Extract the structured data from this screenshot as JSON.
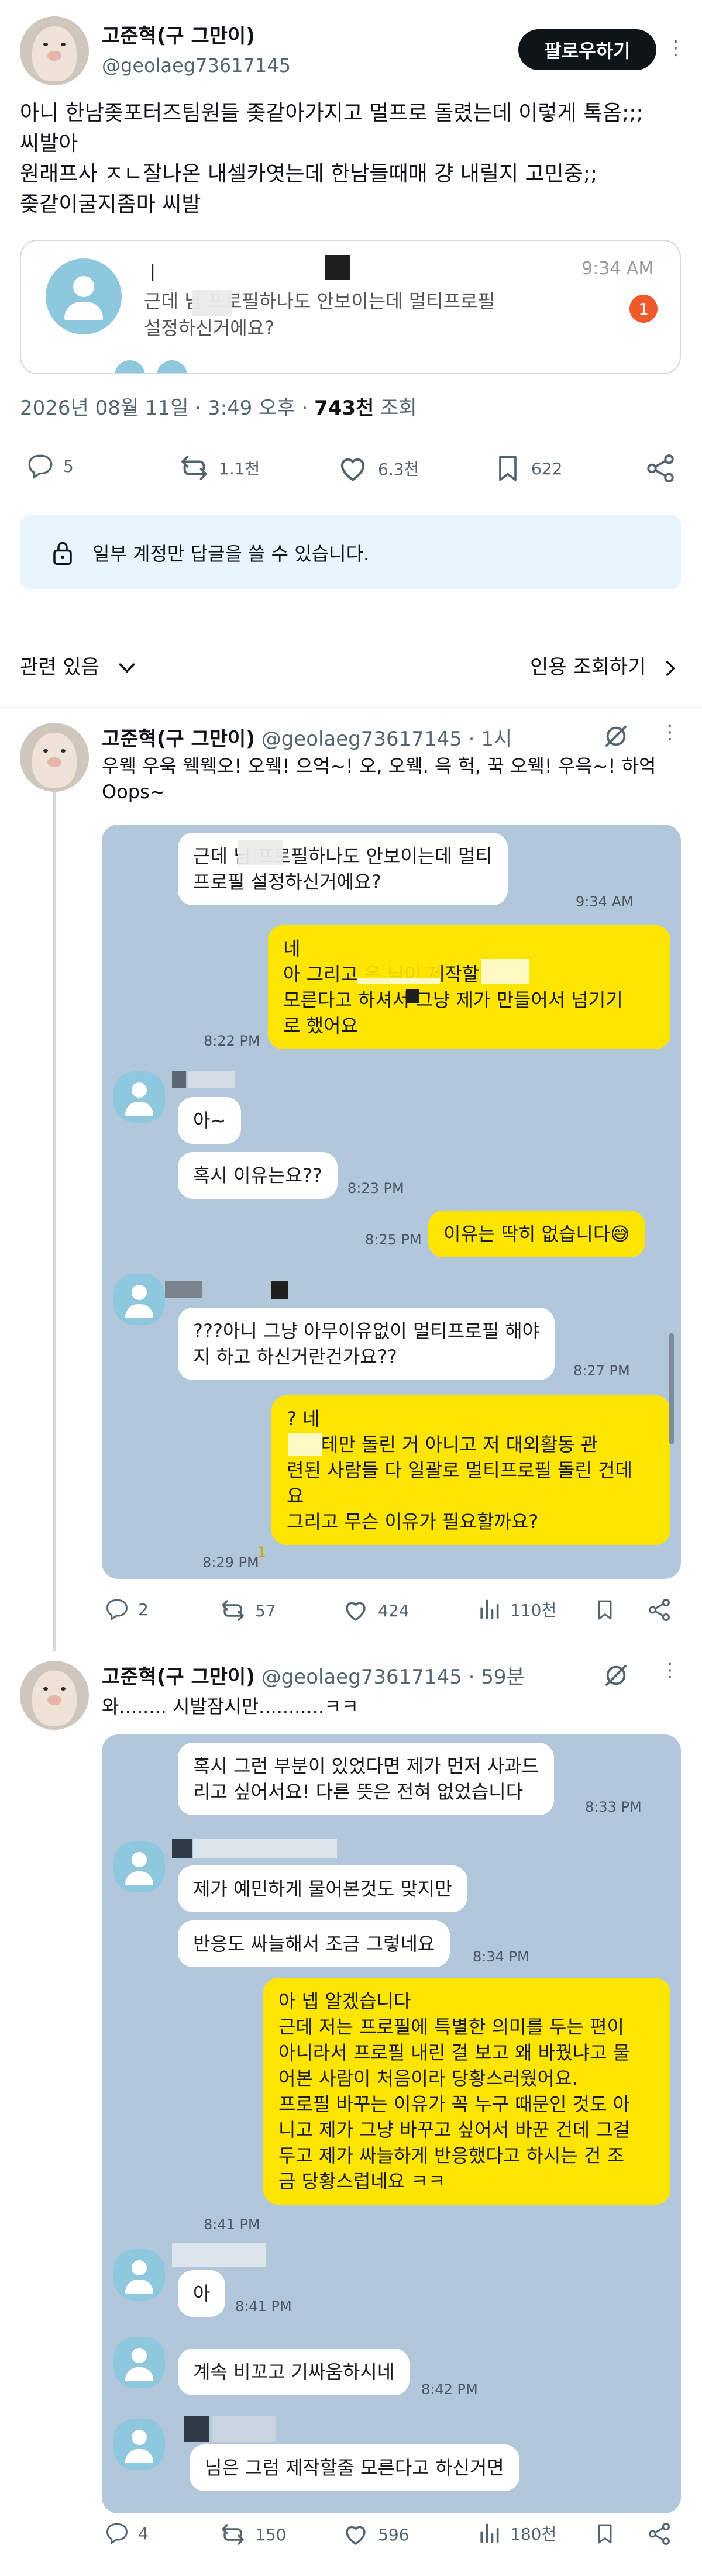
{
  "main_tweet": {
    "display_name": "고준혁(구 그만이)",
    "handle": "@geolaeg73617145",
    "follow_label": "팔로우하기",
    "lines": [
      "아니 한남좆포터즈팀원들 좆같아가지고 멀프로 돌렸는데 이렇게 톡옴;;;",
      "씨발아",
      "원래프사 ㅈㄴ잘나온 내셀카엿는데 한남들때매 걍 내릴지 고민중;;",
      "좆같이굴지좀마 씨발"
    ],
    "card": {
      "name": "ㅣ",
      "message_line1": "근데        님 프로필하나도 안보이는데 멀티프로필",
      "message_line2": "설정하신거에요?",
      "time": "9:34 AM",
      "badge": "1"
    },
    "meta": {
      "date": "2026년 08월 11일 · 3:49 오후 · ",
      "views": "743천",
      "views_label": " 조회"
    },
    "actions": {
      "replies": "5",
      "retweets": "1.1천",
      "likes": "6.3천",
      "bookmarks": "622"
    }
  },
  "reply_notice": "일부 계정만 답글을 쓸 수 있습니다.",
  "section": {
    "left": "관련 있음",
    "right": "인용 조회하기"
  },
  "reply1": {
    "display_name": "고준혁(구 그만이)",
    "handle": "@geolaeg73617145 · 1시",
    "text_lines": [
      "우웩 우욱 웩웩오! 오웩! 으억~! 오, 오웩. 윽 헉, 꾹 오웩! 우윽~! 하억",
      "Oops~"
    ],
    "chat": {
      "b1": [
        "근데        님 프로필하나도 안보이는데 멀티",
        "프로필 설정하신거에요?"
      ],
      "t1": "9:34 AM",
      "b2": [
        "네",
        "아 그리고              은       님이 제작할 줄",
        "모른다고 하셔서 그냥 제가 만들어서 넘기기",
        "로 했어요"
      ],
      "t2": "8:22 PM",
      "b3": "아~",
      "b4": "혹시 이유는요??",
      "t4": "8:23 PM",
      "t5": "8:25 PM",
      "b5": "이유는 딱히 없습니다😅",
      "b6": [
        "???아니 그냥 아무이유없이 멀티프로필 해야",
        "지 하고 하신거란건가요??"
      ],
      "t6": "8:27 PM",
      "b7": [
        "? 네",
        "      님한테만 돌린 거 아니고 저 대외활동 관",
        "련된 사람들 다 일괄로 멀티프로필 돌린 건데",
        "요",
        "그리고 무슨 이유가 필요할까요?"
      ],
      "t7": "8:29 PM",
      "t7_badge": "1"
    },
    "actions": {
      "replies": "2",
      "retweets": "57",
      "likes": "424",
      "views": "110천"
    }
  },
  "reply2": {
    "display_name": "고준혁(구 그만이)",
    "handle": "@geolaeg73617145 · 59분",
    "text": "와........ 시발잠시만...........ㅋㅋ",
    "chat": {
      "b1": [
        "혹시 그런 부분이 있었다면 제가 먼저 사과드",
        "리고 싶어서요! 다른 뜻은 전혀 없었습니다"
      ],
      "t1": "8:33 PM",
      "b2": "제가 예민하게 물어본것도 맞지만",
      "b3": "반응도 싸늘해서 조금 그렇네요",
      "t3": "8:34 PM",
      "b4": [
        "아 넵 알겠습니다",
        "근데 저는 프로필에 특별한 의미를 두는 편이",
        "아니라서 프로필 내린 걸 보고 왜 바꿨냐고 물",
        "어본 사람이 처음이라 당황스러웠어요.",
        "프로필 바꾸는 이유가 꼭 누구 때문인 것도 아",
        "니고 제가 그냥 바꾸고 싶어서 바꾼 건데 그걸",
        "두고 제가 싸늘하게 반응했다고 하시는 건 조",
        "금 당황스럽네요 ㅋㅋ"
      ],
      "t4": "8:41 PM",
      "b5": "아",
      "t5": "8:41 PM",
      "b6": "계속 비꼬고 기싸움하시네",
      "t6": "8:42 PM",
      "b7": "님은 그럼 제작할줄 모른다고 하신거면"
    },
    "actions": {
      "replies": "4",
      "retweets": "150",
      "likes": "596",
      "views": "180천"
    }
  },
  "colors": {
    "follow_bg": "#0f1419",
    "chat_bg": "#b2c7d9",
    "bubble_yellow": "#fee500",
    "notice_bg": "#e8f5fd",
    "badge": "#f05a2a"
  }
}
